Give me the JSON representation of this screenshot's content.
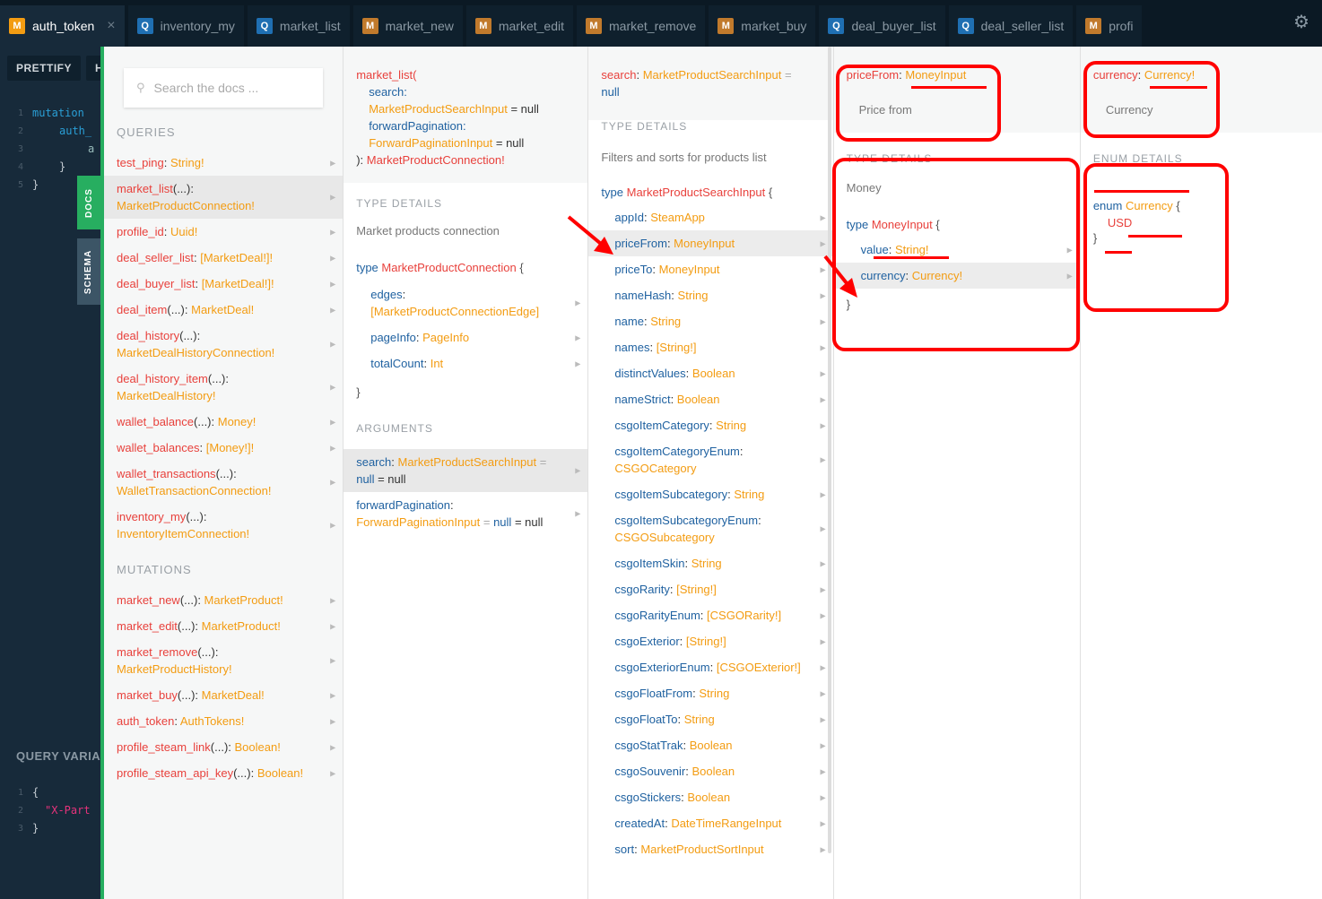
{
  "tabs": [
    {
      "badge": "M",
      "label": "auth_token",
      "active": true
    },
    {
      "badge": "Q",
      "label": "inventory_my"
    },
    {
      "badge": "Q",
      "label": "market_list"
    },
    {
      "badge": "M",
      "label": "market_new"
    },
    {
      "badge": "M",
      "label": "market_edit"
    },
    {
      "badge": "M",
      "label": "market_remove"
    },
    {
      "badge": "M",
      "label": "market_buy"
    },
    {
      "badge": "Q",
      "label": "deal_buyer_list"
    },
    {
      "badge": "Q",
      "label": "deal_seller_list"
    },
    {
      "badge": "M",
      "label": "profi"
    }
  ],
  "tab_close": "×",
  "editor": {
    "prettify": "PRETTIFY",
    "history_fragment": "H",
    "lines": [
      {
        "n": "1",
        "code": "mutation"
      },
      {
        "n": "2",
        "code": "auth_"
      },
      {
        "n": "3",
        "code": "a"
      },
      {
        "n": "4",
        "code": "}"
      },
      {
        "n": "5",
        "code": "}"
      }
    ],
    "query_variables_title": "QUERY VARIA",
    "var_lines": [
      {
        "n": "1",
        "code": "{"
      },
      {
        "n": "2",
        "code": "\"X-Part"
      },
      {
        "n": "3",
        "code": "}"
      }
    ]
  },
  "side_tabs": {
    "docs": "DOCS",
    "schema": "SCHEMA"
  },
  "docs": {
    "search_placeholder": "Search the docs ...",
    "queries_title": "QUERIES",
    "queries": [
      {
        "name": "test_ping",
        "args": "",
        "type": "String!"
      },
      {
        "name": "market_list",
        "args": "(...)",
        "type": "MarketProductConnection!",
        "selected": true
      },
      {
        "name": "profile_id",
        "args": "",
        "type": "Uuid!"
      },
      {
        "name": "deal_seller_list",
        "args": "",
        "type": "[MarketDeal!]!"
      },
      {
        "name": "deal_buyer_list",
        "args": "",
        "type": "[MarketDeal!]!"
      },
      {
        "name": "deal_item",
        "args": "(...)",
        "type": "MarketDeal!"
      },
      {
        "name": "deal_history",
        "args": "(...)",
        "type": "MarketDealHistoryConnection!"
      },
      {
        "name": "deal_history_item",
        "args": "(...)",
        "type": "MarketDealHistory!"
      },
      {
        "name": "wallet_balance",
        "args": "(...)",
        "type": "Money!"
      },
      {
        "name": "wallet_balances",
        "args": "",
        "type": "[Money!]!"
      },
      {
        "name": "wallet_transactions",
        "args": "(...)",
        "type": "WalletTransactionConnection!"
      },
      {
        "name": "inventory_my",
        "args": "(...)",
        "type": "InventoryItemConnection!"
      }
    ],
    "mutations_title": "MUTATIONS",
    "mutations": [
      {
        "name": "market_new",
        "args": "(...)",
        "type": "MarketProduct!"
      },
      {
        "name": "market_edit",
        "args": "(...)",
        "type": "MarketProduct!"
      },
      {
        "name": "market_remove",
        "args": "(...)",
        "type": "MarketProductHistory!"
      },
      {
        "name": "market_buy",
        "args": "(...)",
        "type": "MarketDeal!"
      },
      {
        "name": "auth_token",
        "args": "",
        "type": "AuthTokens!"
      },
      {
        "name": "profile_steam_link",
        "args": "(...)",
        "type": "Boolean!"
      },
      {
        "name": "profile_steam_api_key",
        "args": "(...)",
        "type": "Boolean!"
      }
    ]
  },
  "market_list_col": {
    "sig_name": "market_list(",
    "sig_args": [
      {
        "name": "search",
        "type": "MarketProductSearchInput",
        "default": "= null"
      },
      {
        "name": "forwardPagination",
        "type": "ForwardPaginationInput",
        "default": "= null"
      }
    ],
    "sig_close": "): ",
    "sig_return": "MarketProductConnection!",
    "type_details_title": "TYPE DETAILS",
    "description": "Market products connection",
    "type_kw": "type ",
    "type_name": "MarketProductConnection",
    "open_brace": " {",
    "fields": [
      {
        "name": "edges",
        "type": "[MarketProductConnectionEdge]"
      },
      {
        "name": "pageInfo",
        "type": "PageInfo"
      },
      {
        "name": "totalCount",
        "type": "Int"
      }
    ],
    "close_brace": "}",
    "arguments_title": "ARGUMENTS",
    "arguments": [
      {
        "name": "search",
        "type": "MarketProductSearchInput",
        "eq": " = ",
        "null_kw": "null",
        "default": " = null",
        "selected": true
      },
      {
        "name": "forwardPagination",
        "type": "ForwardPaginationInput",
        "eq": " = ",
        "null_kw": "null",
        "default": " = null"
      }
    ]
  },
  "search_col": {
    "hdr_name": "search",
    "hdr_type": "MarketProductSearchInput",
    "hdr_eq": " =",
    "hdr_null": "null",
    "type_details_title": "TYPE DETAILS",
    "description": "Filters and sorts for products list",
    "type_kw": "type ",
    "type_name": "MarketProductSearchInput",
    "open_brace": " {",
    "fields": [
      {
        "name": "appId",
        "type": "SteamApp"
      },
      {
        "name": "priceFrom",
        "type": "MoneyInput",
        "selected": true
      },
      {
        "name": "priceTo",
        "type": "MoneyInput"
      },
      {
        "name": "nameHash",
        "type": "String"
      },
      {
        "name": "name",
        "type": "String"
      },
      {
        "name": "names",
        "type": "[String!]"
      },
      {
        "name": "distinctValues",
        "type": "Boolean"
      },
      {
        "name": "nameStrict",
        "type": "Boolean"
      },
      {
        "name": "csgoItemCategory",
        "type": "String"
      },
      {
        "name": "csgoItemCategoryEnum",
        "type": "CSGOCategory"
      },
      {
        "name": "csgoItemSubcategory",
        "type": "String"
      },
      {
        "name": "csgoItemSubcategoryEnum",
        "type": "CSGOSubcategory"
      },
      {
        "name": "csgoItemSkin",
        "type": "String"
      },
      {
        "name": "csgoRarity",
        "type": "[String!]"
      },
      {
        "name": "csgoRarityEnum",
        "type": "[CSGORarity!]"
      },
      {
        "name": "csgoExterior",
        "type": "[String!]"
      },
      {
        "name": "csgoExteriorEnum",
        "type": "[CSGOExterior!]"
      },
      {
        "name": "csgoFloatFrom",
        "type": "String"
      },
      {
        "name": "csgoFloatTo",
        "type": "String"
      },
      {
        "name": "csgoStatTrak",
        "type": "Boolean"
      },
      {
        "name": "csgoSouvenir",
        "type": "Boolean"
      },
      {
        "name": "csgoStickers",
        "type": "Boolean"
      },
      {
        "name": "createdAt",
        "type": "DateTimeRangeInput"
      },
      {
        "name": "sort",
        "type": "MarketProductSortInput"
      }
    ]
  },
  "pricefrom_col": {
    "hdr_name": "priceFrom",
    "hdr_type": "MoneyInput",
    "description": "Price from",
    "type_details_title": "TYPE DETAILS",
    "type_desc": "Money",
    "type_kw": "type ",
    "type_name": "MoneyInput",
    "open_brace": " {",
    "fields": [
      {
        "name": "value",
        "type": "String!"
      },
      {
        "name": "currency",
        "type": "Currency!",
        "selected": true
      }
    ],
    "close_brace": "}"
  },
  "currency_col": {
    "hdr_name": "currency",
    "hdr_type": "Currency!",
    "description": "Currency",
    "enum_details_title": "ENUM DETAILS",
    "enum_kw": "enum ",
    "enum_name": "Currency",
    "open_brace": " {",
    "values": [
      "USD"
    ],
    "close_brace": "}"
  },
  "colors": {
    "accent_green": "#27ae60",
    "field_name": "#e8413c",
    "field_type": "#f39c12",
    "keyword": "#1f61a0",
    "annotation": "#ff0000"
  }
}
